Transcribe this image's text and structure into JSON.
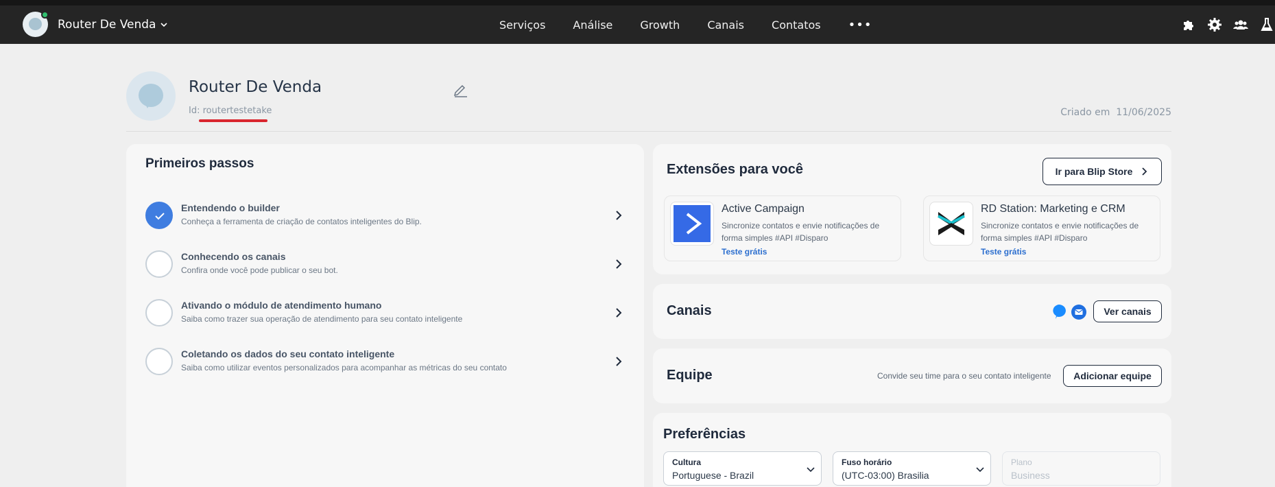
{
  "app": {
    "bot_name": "Router De Venda"
  },
  "nav": {
    "items": [
      "Serviços",
      "Análise",
      "Growth",
      "Canais",
      "Contatos"
    ],
    "more": "•••"
  },
  "header_icons": [
    "puzzle-icon",
    "settings-icon",
    "team-icon",
    "lab-flask-icon"
  ],
  "profile": {
    "name": "Router De Venda",
    "id_label": "Id:",
    "id_value": "routertestetake",
    "created_label": "Criado em",
    "created_date": "11/06/2025"
  },
  "first_steps": {
    "title": "Primeiros passos",
    "items": [
      {
        "title": "Entendendo o builder",
        "subtitle": "Conheça a ferramenta de criação de contatos inteligentes do Blip.",
        "done": true
      },
      {
        "title": "Conhecendo os canais",
        "subtitle": "Confira onde você pode publicar o seu bot.",
        "done": false
      },
      {
        "title": "Ativando o módulo de atendimento humano",
        "subtitle": "Saiba como trazer sua operação de atendimento para seu contato inteligente",
        "done": false
      },
      {
        "title": "Coletando os dados do seu contato inteligente",
        "subtitle": "Saiba como utilizar eventos personalizados para acompanhar as métricas do seu contato",
        "done": false
      }
    ]
  },
  "extensions": {
    "title": "Extensões para você",
    "store_button": "Ir para Blip Store",
    "items": [
      {
        "name": "Active Campaign",
        "desc": "Sincronize contatos e envie notificações de forma simples #API #Disparo",
        "cta": "Teste grátis"
      },
      {
        "name": "RD Station: Marketing e CRM",
        "desc": "Sincronize contatos e envie notificações de forma simples #API #Disparo",
        "cta": "Teste grátis"
      }
    ]
  },
  "channels": {
    "title": "Canais",
    "button": "Ver canais"
  },
  "team": {
    "title": "Equipe",
    "note": "Convide seu time para o seu contato inteligente",
    "button": "Adicionar equipe"
  },
  "preferences": {
    "title": "Preferências",
    "culture": {
      "label": "Cultura",
      "value": "Portuguese - Brazil"
    },
    "timezone": {
      "label": "Fuso horário",
      "value": "(UTC-03:00) Brasilia"
    },
    "plan": {
      "label": "Plano",
      "value": "Business"
    }
  },
  "colors": {
    "accent": "#3f7de0",
    "topbar": "#252525",
    "link": "#2c6fcf",
    "highlight_underline": "#d9252e"
  }
}
